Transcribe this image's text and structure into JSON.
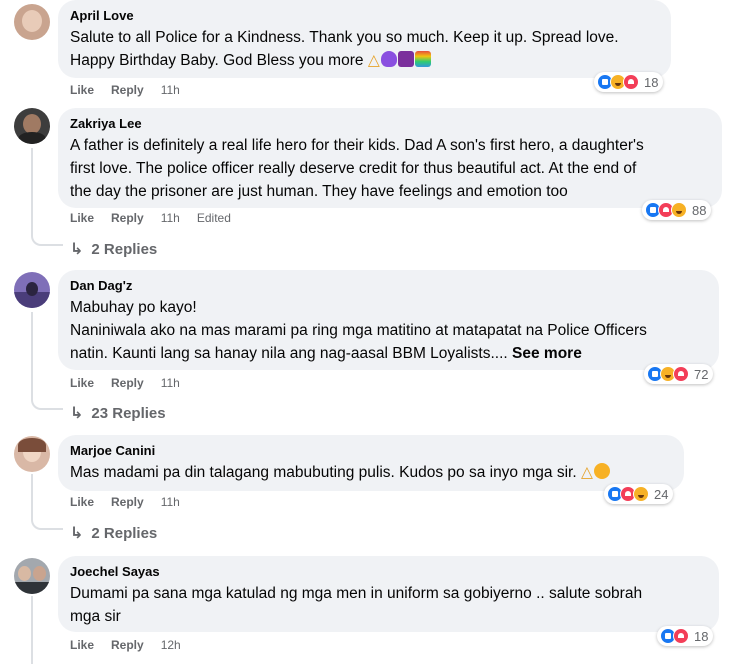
{
  "comments": [
    {
      "author": "April Love",
      "lines": [
        "Salute to all Police for a Kindness. Thank you so much. Keep it up. Spread love.",
        "Happy Birthday Baby. God Bless you more"
      ],
      "like": "Like",
      "reply": "Reply",
      "time": "11h",
      "edited": "",
      "reaction_count": "18",
      "reaction_icons": [
        "like-icon",
        "care-icon",
        "love-icon"
      ],
      "avatar_color": "#c9a48f"
    },
    {
      "author": "Zakriya Lee",
      "lines": [
        "A father is definitely a real life hero for their kids. Dad A son's first hero, a daughter's",
        "first love. The police officer really deserve credit for thus beautiful act. At the end of",
        "the day the prisoner are just human. They have feelings and emotion too"
      ],
      "like": "Like",
      "reply": "Reply",
      "time": "11h",
      "edited": "Edited",
      "reaction_count": "88",
      "reaction_icons": [
        "like-icon",
        "love-icon",
        "care-icon"
      ],
      "replies": "2 Replies",
      "avatar_color": "#5a5a5a"
    },
    {
      "author": "Dan Dag'z",
      "lines": [
        "Mabuhay po kayo!",
        "Naniniwala ako na mas marami pa ring mga matitino at matapatat na Police Officers",
        "natin. Kaunti lang sa hanay nila ang nag-aasal BBM Loyalists...."
      ],
      "see_more": "See more",
      "like": "Like",
      "reply": "Reply",
      "time": "11h",
      "edited": "",
      "reaction_count": "72",
      "reaction_icons": [
        "like-icon",
        "haha-icon",
        "love-icon"
      ],
      "replies": "23 Replies",
      "avatar_color": "#6b5aa6"
    },
    {
      "author": "Marjoe Canini",
      "lines": [
        "Mas madami pa din talagang mabubuting pulis. Kudos po sa inyo mga sir."
      ],
      "like": "Like",
      "reply": "Reply",
      "time": "11h",
      "edited": "",
      "reaction_count": "24",
      "reaction_icons": [
        "like-icon",
        "love-icon",
        "care-icon"
      ],
      "replies": "2 Replies",
      "avatar_color": "#b88a70"
    },
    {
      "author": "Joechel Sayas",
      "lines": [
        "Dumami pa sana mga katulad ng mga men in uniform sa gobiyerno .. salute sobrah",
        "mga sir"
      ],
      "like": "Like",
      "reply": "Reply",
      "time": "12h",
      "edited": "",
      "reaction_count": "18",
      "reaction_icons": [
        "like-icon",
        "love-icon"
      ],
      "avatar_color": "#8a8f96"
    }
  ]
}
